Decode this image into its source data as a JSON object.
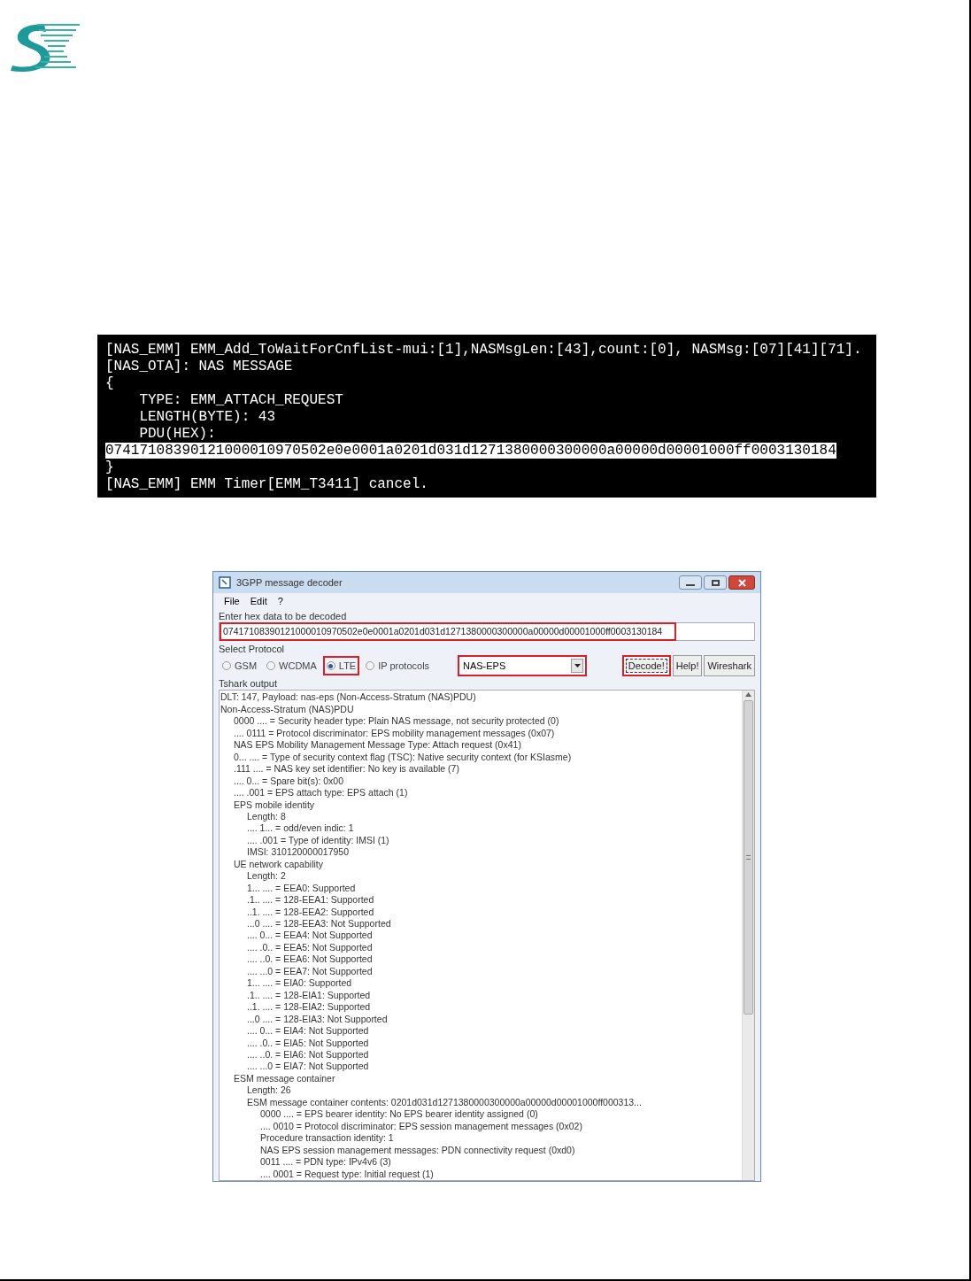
{
  "terminal": {
    "lines": [
      {
        "text": "[NAS_EMM] EMM_Add_ToWaitForCnfList-mui:[1],NASMsgLen:[43],count:[0], NASMsg:[07][41][71].",
        "highlighted": false
      },
      {
        "text": "[NAS_OTA]: NAS MESSAGE",
        "highlighted": false
      },
      {
        "text": "{",
        "highlighted": false
      },
      {
        "text": "    TYPE: EMM_ATTACH_REQUEST",
        "highlighted": false
      },
      {
        "text": "    LENGTH(BYTE): 43",
        "highlighted": false
      },
      {
        "text": "    PDU(HEX):",
        "highlighted": false
      },
      {
        "text": "07417108390121000010970502e0e0001a0201d031d1271380000300000a00000d00001000ff0003130184",
        "highlighted": true
      },
      {
        "text": "}",
        "highlighted": false
      },
      {
        "text": "[NAS_EMM] EMM Timer[EMM_T3411] cancel.",
        "highlighted": false
      }
    ]
  },
  "decoder": {
    "window": {
      "title": "3GPP message decoder"
    },
    "menu": [
      "File",
      "Edit",
      "?"
    ],
    "hex_input": {
      "label": "Enter hex data to be decoded",
      "value": "07417108390121000010970502e0e0001a0201d031d1271380000300000a00000d00001000ff0003130184",
      "outlined": true
    },
    "protocol": {
      "label": "Select Protocol",
      "options": [
        {
          "label": "GSM",
          "selected": false,
          "outlined": false
        },
        {
          "label": "WCDMA",
          "selected": false,
          "outlined": false
        },
        {
          "label": "LTE",
          "selected": true,
          "outlined": true
        },
        {
          "label": "IP protocols",
          "selected": false,
          "outlined": false
        }
      ],
      "dropdown": {
        "value": "NAS-EPS",
        "outlined": true
      },
      "buttons": [
        {
          "label": "Decode!",
          "outlined": true
        },
        {
          "label": "Help!",
          "outlined": false
        },
        {
          "label": "Wireshark",
          "outlined": false
        }
      ]
    },
    "output": {
      "label": "Tshark output",
      "tree": [
        {
          "text": "DLT: 147, Payload: nas-eps (Non-Access-Stratum (NAS)PDU)"
        },
        {
          "text": "Non-Access-Stratum (NAS)PDU",
          "children": [
            {
              "text": "0000 .... = Security header type: Plain NAS message, not security protected (0)"
            },
            {
              "text": ".... 0111 = Protocol discriminator: EPS mobility management messages (0x07)"
            },
            {
              "text": "NAS EPS Mobility Management Message Type: Attach request (0x41)"
            },
            {
              "text": "0... .... = Type of security context flag (TSC): Native security context (for KSIasme)"
            },
            {
              "text": ".111 .... = NAS key set identifier: No key is available (7)"
            },
            {
              "text": ".... 0... = Spare bit(s): 0x00"
            },
            {
              "text": ".... .001 = EPS attach type: EPS attach (1)"
            },
            {
              "text": "EPS mobile identity",
              "children": [
                {
                  "text": "Length: 8"
                },
                {
                  "text": ".... 1... = odd/even indic: 1"
                },
                {
                  "text": ".... .001 = Type of identity: IMSI (1)"
                },
                {
                  "text": "IMSI: 310120000017950"
                }
              ]
            },
            {
              "text": "UE network capability",
              "children": [
                {
                  "text": "Length: 2"
                },
                {
                  "text": "1... .... = EEA0: Supported"
                },
                {
                  "text": ".1.. .... = 128-EEA1: Supported"
                },
                {
                  "text": "..1. .... = 128-EEA2: Supported"
                },
                {
                  "text": "...0 .... = 128-EEA3: Not Supported"
                },
                {
                  "text": ".... 0... = EEA4: Not Supported"
                },
                {
                  "text": ".... .0.. = EEA5: Not Supported"
                },
                {
                  "text": ".... ..0. = EEA6: Not Supported"
                },
                {
                  "text": ".... ...0 = EEA7: Not Supported"
                },
                {
                  "text": "1... .... = EIA0: Supported"
                },
                {
                  "text": ".1.. .... = 128-EIA1: Supported"
                },
                {
                  "text": "..1. .... = 128-EIA2: Supported"
                },
                {
                  "text": "...0 .... = 128-EIA3: Not Supported"
                },
                {
                  "text": ".... 0... = EIA4: Not Supported"
                },
                {
                  "text": ".... .0.. = EIA5: Not Supported"
                },
                {
                  "text": ".... ..0. = EIA6: Not Supported"
                },
                {
                  "text": ".... ...0 = EIA7: Not Supported"
                }
              ]
            },
            {
              "text": "ESM message container",
              "children": [
                {
                  "text": "Length: 26"
                },
                {
                  "text": "ESM message container contents: 0201d031d1271380000300000a00000d00001000ff000313...",
                  "children": [
                    {
                      "text": "0000 .... = EPS bearer identity: No EPS bearer identity assigned (0)"
                    },
                    {
                      "text": ".... 0010 = Protocol discriminator: EPS session management messages (0x02)"
                    },
                    {
                      "text": "Procedure transaction identity: 1"
                    },
                    {
                      "text": "NAS EPS session management messages: PDN connectivity request (0xd0)"
                    },
                    {
                      "text": "0011 .... = PDN type: IPv4v6 (3)"
                    },
                    {
                      "text": ".... 0001 = Request type: Initial request (1)"
                    }
                  ]
                }
              ]
            }
          ]
        }
      ]
    }
  }
}
